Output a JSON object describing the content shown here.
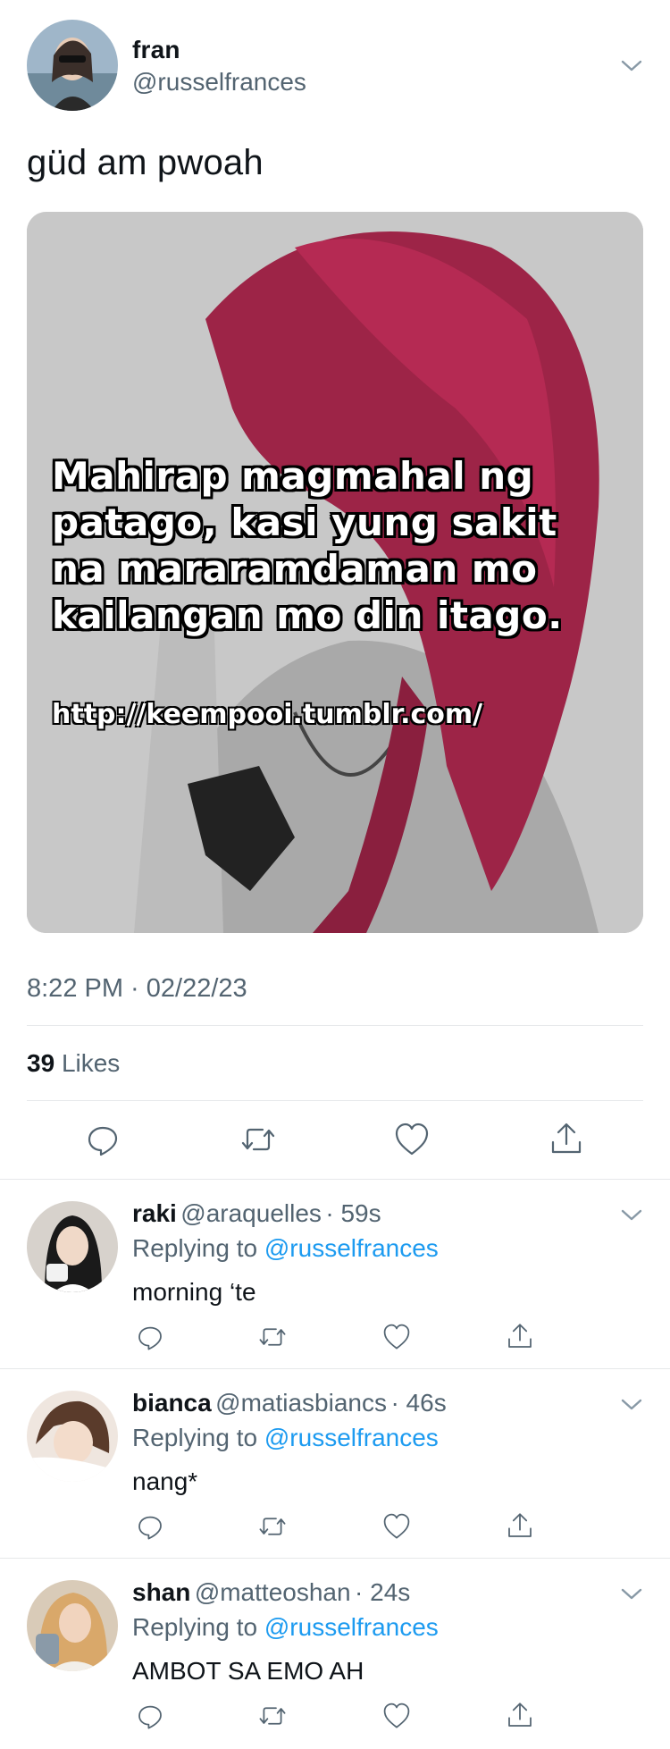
{
  "tweet": {
    "author_name": "fran",
    "author_handle": "@russelfrances",
    "text": "güd am pwoah",
    "image_caption": "Mahirap magmahal ng patago, kasi yung sakit na mararamdaman mo kailangan mo din itago.",
    "image_url_text": "http://keempooi.tumblr.com/",
    "timestamp": "8:22 PM · 02/22/23",
    "likes_count": "39",
    "likes_label": "Likes"
  },
  "replies": [
    {
      "name": "raki",
      "handle": "@araquelles",
      "time": "· 59s",
      "replying_label": "Replying to",
      "replying_to": "@russelfrances",
      "text": "morning ‘te"
    },
    {
      "name": "bianca",
      "handle": "@matiasbiancs",
      "time": "· 46s",
      "replying_label": "Replying to",
      "replying_to": "@russelfrances",
      "text": "nang*"
    },
    {
      "name": "shan",
      "handle": "@matteoshan",
      "time": "· 24s",
      "replying_label": "Replying to",
      "replying_to": "@russelfrances",
      "text": "AMBOT SA EMO AH"
    }
  ],
  "icons": {
    "more": "chevron-down-icon",
    "reply": "reply-icon",
    "retweet": "retweet-icon",
    "like": "heart-icon",
    "share": "share-icon"
  },
  "colors": {
    "link": "#1d9bf0",
    "secondary_text": "#536471",
    "divider": "#e6e8ea"
  }
}
